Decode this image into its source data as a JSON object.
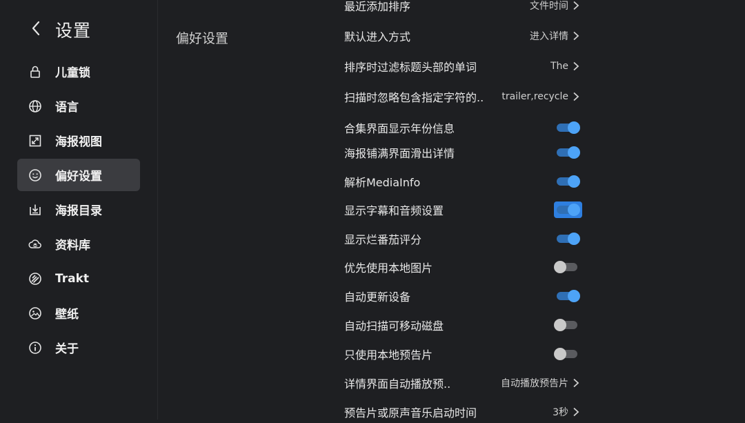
{
  "header": {
    "title": "设置",
    "back_icon": "chevron-left-icon"
  },
  "sidebar": {
    "items": [
      {
        "label": "儿童锁",
        "icon": "lock-icon"
      },
      {
        "label": "语言",
        "icon": "globe-icon"
      },
      {
        "label": "海报视图",
        "icon": "expand-icon"
      },
      {
        "label": "偏好设置",
        "icon": "smiley-icon",
        "active": true
      },
      {
        "label": "海报目录",
        "icon": "download-box-icon"
      },
      {
        "label": "资料库",
        "icon": "cloud-stack-icon"
      },
      {
        "label": "Trakt",
        "icon": "trakt-icon"
      },
      {
        "label": "壁纸",
        "icon": "wallpaper-icon"
      },
      {
        "label": "关于",
        "icon": "info-icon"
      }
    ]
  },
  "section": {
    "title": "偏好设置"
  },
  "settings": [
    {
      "label": "最近添加排序",
      "type": "select",
      "value": "文件时间"
    },
    {
      "label": "默认进入方式",
      "type": "select",
      "value": "进入详情"
    },
    {
      "label": "排序时过滤标题头部的单词",
      "type": "select",
      "value": "The"
    },
    {
      "label": "扫描时忽略包含指定字符的..",
      "type": "select",
      "value": "trailer,recycle"
    },
    {
      "label": "合集界面显示年份信息",
      "type": "toggle",
      "on": true
    },
    {
      "label": "海报铺满界面滑出详情",
      "type": "toggle",
      "on": true
    },
    {
      "label": "解析MediaInfo",
      "type": "toggle",
      "on": true
    },
    {
      "label": "显示字幕和音频设置",
      "type": "toggle",
      "on": true,
      "focused": true
    },
    {
      "label": "显示烂番茄评分",
      "type": "toggle",
      "on": true
    },
    {
      "label": "优先使用本地图片",
      "type": "toggle",
      "on": false
    },
    {
      "label": "自动更新设备",
      "type": "toggle",
      "on": true
    },
    {
      "label": "自动扫描可移动磁盘",
      "type": "toggle",
      "on": false
    },
    {
      "label": "只使用本地预告片",
      "type": "toggle",
      "on": false
    },
    {
      "label": "详情界面自动播放预..",
      "type": "select",
      "value": "自动播放预告片"
    },
    {
      "label": "预告片或原声音乐启动时间",
      "type": "select",
      "value": "3秒"
    }
  ],
  "colors": {
    "background": "#1e1f22",
    "active_nav": "#3b3c40",
    "accent": "#4da3f7",
    "focus": "#2e7fe0"
  }
}
